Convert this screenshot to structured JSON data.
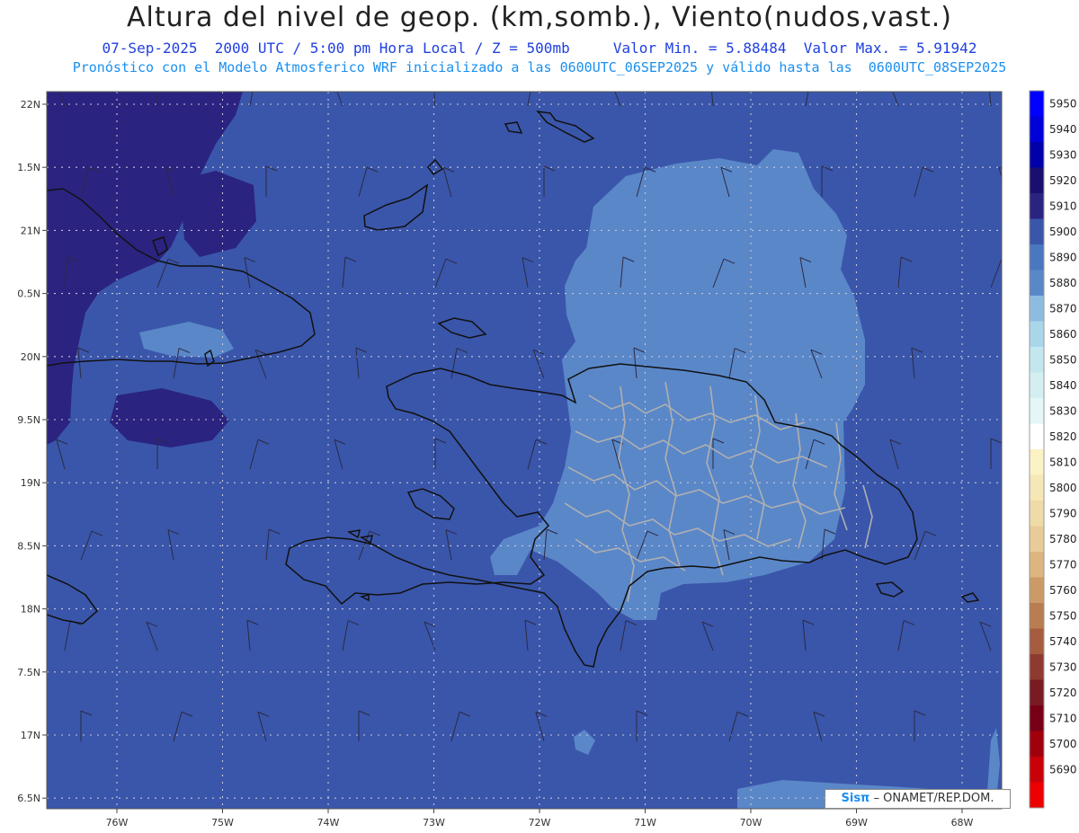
{
  "header": {
    "title": "Altura del nivel de geop. (km,somb.), Viento(nudos,vast.)",
    "subtitle": "07-Sep-2025  2000 UTC / 5:00 pm Hora Local / Z = 500mb     Valor Min. = 5.88484  Valor Max. = 5.91942",
    "info": "Pronóstico con el Modelo Atmosferico WRF inicializado a las 0600UTC_06SEP2025 y válido hasta las  0600UTC_08SEP2025"
  },
  "map": {
    "lat_labels": [
      "22N",
      "1.5N",
      "21N",
      "0.5N",
      "20N",
      "9.5N",
      "19N",
      "8.5N",
      "18N",
      "7.5N",
      "17N",
      "6.5N"
    ],
    "lon_labels": [
      "76W",
      "75W",
      "74W",
      "73W",
      "72W",
      "71W",
      "70W",
      "69W",
      "68W"
    ],
    "grid": true,
    "colors": {
      "dark_zone": "#2b2380",
      "base": "#3a56aa",
      "light_zone": "#5a87c8",
      "coast": "#111111",
      "provinces": "#b0b0b0",
      "barbs": "#2a2a44"
    }
  },
  "colorbar": {
    "labels": [
      "5950",
      "5940",
      "5930",
      "5920",
      "5910",
      "5900",
      "5890",
      "5880",
      "5870",
      "5860",
      "5850",
      "5840",
      "5830",
      "5820",
      "5810",
      "5800",
      "5790",
      "5780",
      "5770",
      "5760",
      "5750",
      "5740",
      "5730",
      "5720",
      "5710",
      "5700",
      "5690"
    ],
    "colors": [
      "#0000ff",
      "#0000d8",
      "#0000a8",
      "#1a0f70",
      "#2b2380",
      "#3a56aa",
      "#4a78c0",
      "#5a87c8",
      "#8cbce0",
      "#aad6ea",
      "#c4e6ef",
      "#d4eff2",
      "#e4f6f6",
      "#ffffff",
      "#fbf2c6",
      "#f6e7b6",
      "#efdba8",
      "#e8cb98",
      "#dcb580",
      "#cc9a66",
      "#b87d50",
      "#a65c3e",
      "#8f3a30",
      "#7a1a22",
      "#780016",
      "#a0000c",
      "#c80008",
      "#ec0000"
    ]
  },
  "footer": {
    "credit_logo": "Sisπ",
    "credit_text": " – ONAMET/REP.DOM."
  }
}
